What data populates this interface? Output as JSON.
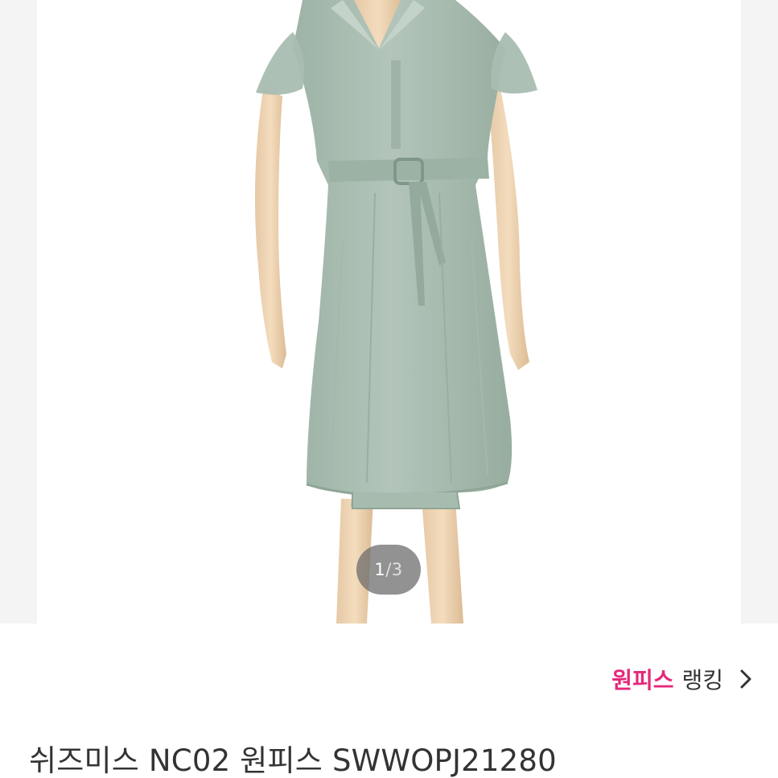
{
  "gallery": {
    "image_alt": "mint green short-sleeve belted shirt dress on mannequin",
    "pager": {
      "current": "1",
      "separator": "/",
      "total": "3"
    }
  },
  "ranking": {
    "category": "원피스",
    "word": "랭킹",
    "category_color": "#e5287a",
    "icon": "chevron-right-icon"
  },
  "product": {
    "title": "쉬즈미스 NC02 원피스 SWWOPJ21280"
  }
}
